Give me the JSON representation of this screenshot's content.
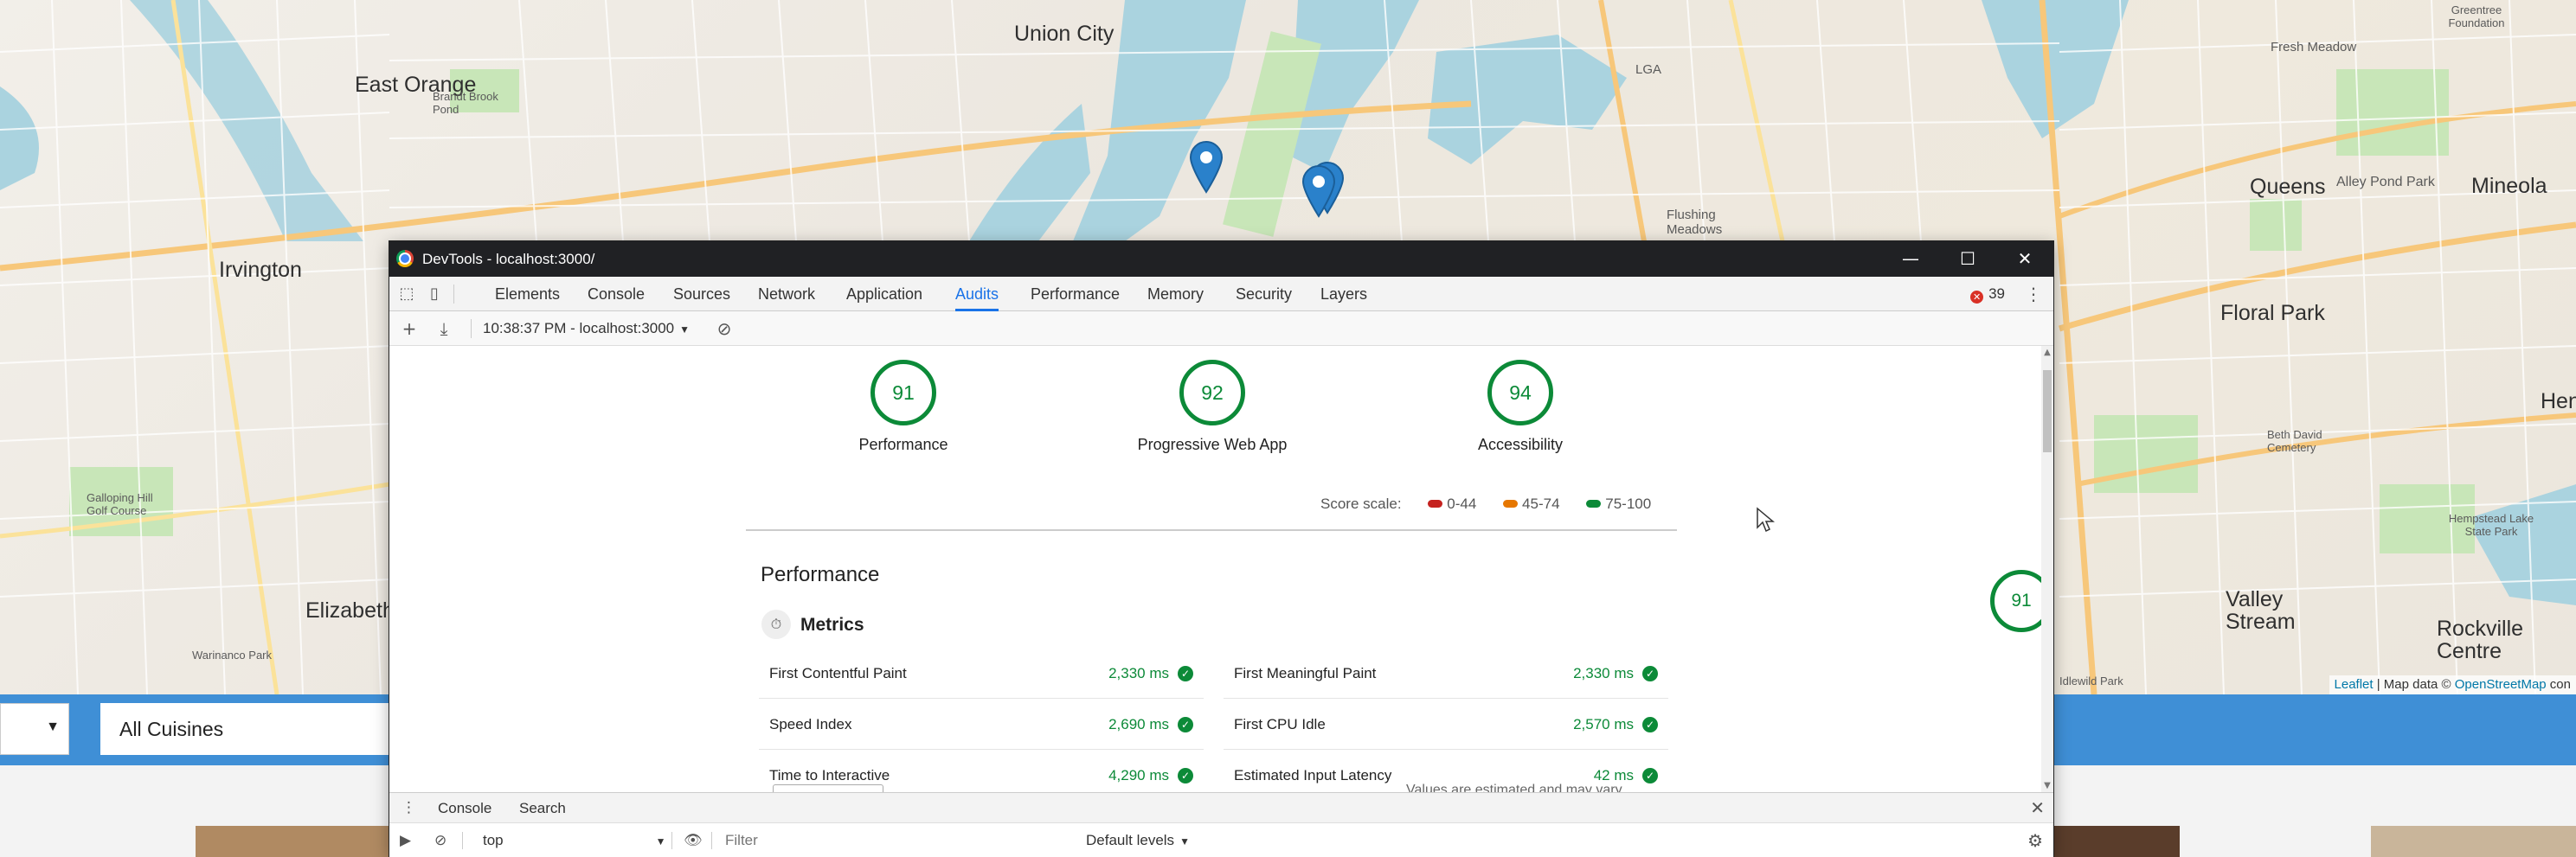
{
  "map": {
    "labels": [
      {
        "text": "Union City",
        "cls": "city"
      },
      {
        "text": "East Orange",
        "cls": "city"
      },
      {
        "text": "Irvington",
        "cls": "city"
      },
      {
        "text": "Elizabeth",
        "cls": "city"
      },
      {
        "text": "Queens",
        "cls": "city"
      },
      {
        "text": "Floral Park",
        "cls": "city"
      },
      {
        "text": "Mineola",
        "cls": "city"
      },
      {
        "text": "Valley Stream",
        "cls": "city"
      },
      {
        "text": "Rockville Centre",
        "cls": "city"
      },
      {
        "text": "Alley Pond Park",
        "cls": "small"
      },
      {
        "text": "Fresh Meadow",
        "cls": "small"
      },
      {
        "text": "Greentree Foundation",
        "cls": "small"
      },
      {
        "text": "Flushing Meadows",
        "cls": "small"
      },
      {
        "text": "Brandt Brook Pond",
        "cls": "small"
      },
      {
        "text": "Galloping Hill Golf Course",
        "cls": "small"
      },
      {
        "text": "Warinanco Park",
        "cls": "small"
      },
      {
        "text": "Beth David Cemetery",
        "cls": "small"
      },
      {
        "text": "Hempstead Lake State Park",
        "cls": "small"
      },
      {
        "text": "LGA",
        "cls": "small"
      },
      {
        "text": "Idlewild Park",
        "cls": "small"
      },
      {
        "text": "Hen",
        "cls": "city"
      }
    ],
    "attribution": {
      "leaflet": "Leaflet",
      "separator": " | Map data © ",
      "osm": "OpenStreetMap",
      "suffix": " con"
    }
  },
  "app": {
    "neighborhood_caret": "▼",
    "cuisine_value": "All Cuisines"
  },
  "devtools": {
    "title": "DevTools - localhost:3000/",
    "window_buttons": {
      "minimize": "—",
      "maximize": "☐",
      "close": "✕"
    },
    "tabs": [
      "Elements",
      "Console",
      "Sources",
      "Network",
      "Application",
      "Audits",
      "Performance",
      "Memory",
      "Security",
      "Layers"
    ],
    "active_tab": "Audits",
    "error_count": "39",
    "kebab": "⋮",
    "audit_toolbar": {
      "add": "+",
      "download": "⤓",
      "report": "10:38:37 PM - localhost:3000",
      "report_arrow": "▼",
      "clear": "⊘"
    },
    "scores": [
      {
        "value": "91",
        "label": "Performance"
      },
      {
        "value": "92",
        "label": "Progressive Web App"
      },
      {
        "value": "94",
        "label": "Accessibility"
      }
    ],
    "scale": {
      "label": "Score scale:",
      "ranges": [
        {
          "text": "0-44",
          "color": "#c5221f"
        },
        {
          "text": "45-74",
          "color": "#e67700"
        },
        {
          "text": "75-100",
          "color": "#0c8a38"
        }
      ]
    },
    "performance": {
      "title": "Performance",
      "score": "91",
      "metrics_title": "Metrics",
      "metrics": [
        {
          "name": "First Contentful Paint",
          "value": "2,330 ms"
        },
        {
          "name": "First Meaningful Paint",
          "value": "2,330 ms"
        },
        {
          "name": "Speed Index",
          "value": "2,690 ms"
        },
        {
          "name": "First CPU Idle",
          "value": "2,570 ms"
        },
        {
          "name": "Time to Interactive",
          "value": "4,290 ms"
        },
        {
          "name": "Estimated Input Latency",
          "value": "42 ms"
        }
      ],
      "note": "Values are estimated and may vary."
    },
    "drawer": {
      "tabs": [
        "Console",
        "Search"
      ],
      "close": "✕",
      "context": "top",
      "context_arrow": "▼",
      "filter_placeholder": "Filter",
      "levels": "Default levels",
      "levels_arrow": "▼"
    }
  }
}
